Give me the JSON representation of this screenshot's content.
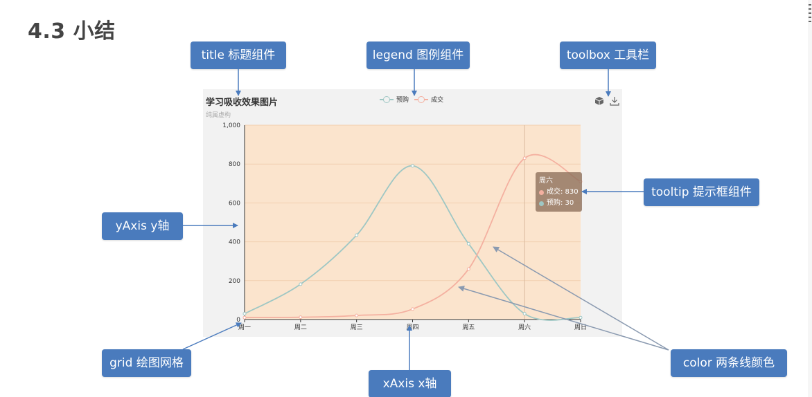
{
  "heading": "4.3 小结",
  "callouts": {
    "title": "title 标题组件",
    "legend": "legend 图例组件",
    "toolbox": "toolbox 工具栏",
    "tooltip": "tooltip 提示框组件",
    "yaxis": "yAxis y轴",
    "grid": "grid 绘图网格",
    "xaxis": "xAxis x轴",
    "color": "color 两条线颜色"
  },
  "toolbox": {
    "icons": [
      "cube-icon",
      "download-icon"
    ]
  },
  "tooltip": {
    "header": "周六",
    "rows": [
      {
        "label": "成交: 830",
        "color": "#f4b0a0"
      },
      {
        "label": "预购: 30",
        "color": "#9ec7c4"
      }
    ]
  },
  "chart_data": {
    "type": "line",
    "title": "学习吸收效果图片",
    "subtitle": "纯属虚构",
    "categories": [
      "周一",
      "周二",
      "周三",
      "周四",
      "周五",
      "周六",
      "周日"
    ],
    "ylim": [
      0,
      1000
    ],
    "yticks": [
      0,
      200,
      400,
      600,
      800,
      1000
    ],
    "ytick_labels": [
      "0",
      "200",
      "400",
      "600",
      "800",
      "1,000"
    ],
    "grid": true,
    "background": "#fbe4cd",
    "series": [
      {
        "name": "预购",
        "color": "#9ec7c4",
        "values": [
          30,
          182,
          434,
          791,
          390,
          30,
          10
        ]
      },
      {
        "name": "成交",
        "color": "#f4b0a0",
        "values": [
          10,
          12,
          21,
          54,
          260,
          830,
          710
        ]
      }
    ],
    "legend_position": "top-center"
  }
}
